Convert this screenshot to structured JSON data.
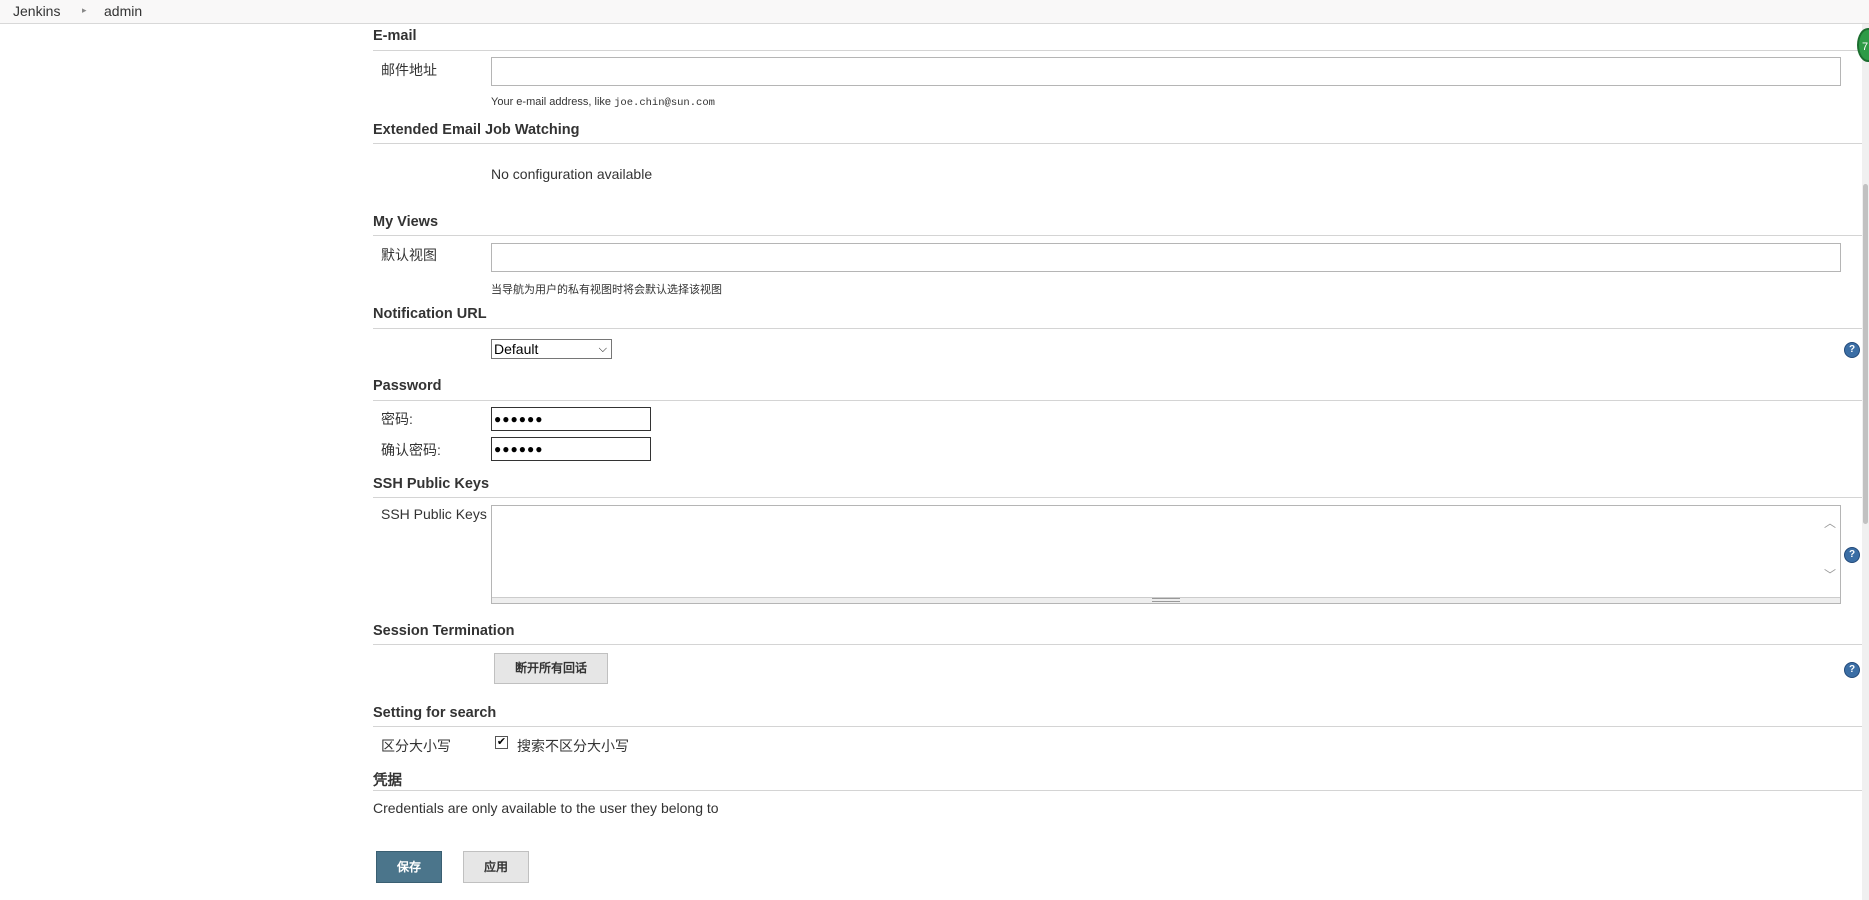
{
  "breadcrumb": {
    "items": [
      "Jenkins",
      "admin"
    ]
  },
  "email": {
    "title": "E-mail",
    "label": "邮件地址",
    "value": "",
    "hint_prefix": "Your e-mail address, like ",
    "hint_example": "joe.chin@sun.com"
  },
  "extended_email": {
    "title": "Extended Email Job Watching",
    "message": "No configuration available"
  },
  "my_views": {
    "title": "My Views",
    "label": "默认视图",
    "value": "",
    "hint": "当导航为用户的私有视图时将会默认选择该视图"
  },
  "notification_url": {
    "title": "Notification URL",
    "selected": "Default"
  },
  "password": {
    "title": "Password",
    "password_label": "密码:",
    "password_value": "●●●●●●",
    "confirm_label": "确认密码:",
    "confirm_value": "●●●●●●"
  },
  "ssh": {
    "title": "SSH Public Keys",
    "label": "SSH Public Keys",
    "value": ""
  },
  "session": {
    "title": "Session Termination",
    "button_label": "断开所有回话"
  },
  "search": {
    "title": "Setting for search",
    "label": "区分大小写",
    "checkbox_label": "搜索不区分大小写",
    "checked": true
  },
  "credentials": {
    "title": "凭据",
    "message": "Credentials are only available to the user they belong to"
  },
  "footer": {
    "save_label": "保存",
    "apply_label": "应用"
  },
  "icons": {
    "help": "help-icon",
    "checkmark": "check-icon",
    "dropdown": "chevron-down-icon"
  },
  "colors": {
    "primary_button": "#4b758b",
    "help_icon": "#3b6ea5",
    "section_line": "#d4d4d4"
  }
}
